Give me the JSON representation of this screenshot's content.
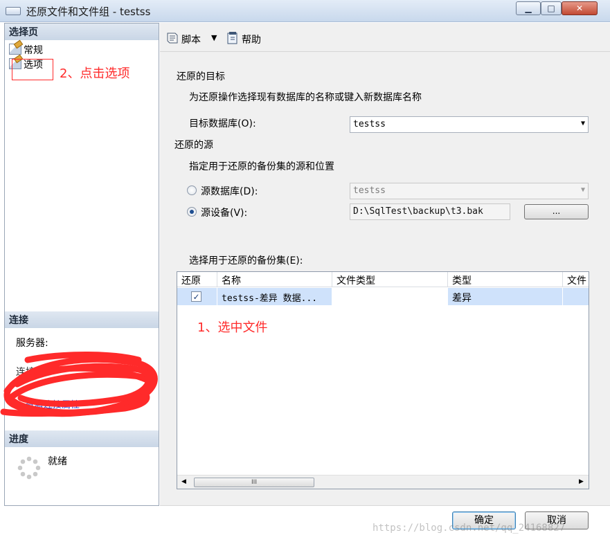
{
  "window": {
    "title": "还原文件和文件组 - testss"
  },
  "left": {
    "select_page_header": "选择页",
    "pages": [
      {
        "label": "常规"
      },
      {
        "label": "选项"
      }
    ],
    "connection_header": "连接",
    "server_label": "服务器:",
    "connection_partial": "连接",
    "view_props_partial": "查看连接属性",
    "progress_header": "进度",
    "progress_status": "就绪"
  },
  "toolbar": {
    "script_label": "脚本",
    "help_label": "帮助"
  },
  "restore_target": {
    "heading": "还原的目标",
    "description": "为还原操作选择现有数据库的名称或键入新数据库名称",
    "target_db_label": "目标数据库(O):",
    "target_db_value": "testss"
  },
  "restore_source": {
    "heading": "还原的源",
    "description": "指定用于还原的备份集的源和位置",
    "source_db_label": "源数据库(D):",
    "source_db_value": "testss",
    "source_device_label": "源设备(V):",
    "source_device_value": "D:\\SqlTest\\backup\\t3.bak",
    "browse_label": "..."
  },
  "backup_sets": {
    "label": "选择用于还原的备份集(E):",
    "columns": [
      "还原",
      "名称",
      "文件类型",
      "类型",
      "文件"
    ],
    "rows": [
      {
        "restore": true,
        "name": "testss-差异 数据...",
        "file_type": "",
        "type": "差异"
      }
    ],
    "scroll_thumb_label": "III"
  },
  "buttons": {
    "ok": "确定",
    "cancel": "取消"
  },
  "annotations": {
    "click_options": "2、点击选项",
    "select_file": "1、选中文件"
  },
  "watermark": "https://blog.csdn.net/qq_24168827",
  "colors": {
    "annotation": "#ff2a2a",
    "selection_row": "#cfe2fb",
    "link": "#1a3fd6"
  }
}
